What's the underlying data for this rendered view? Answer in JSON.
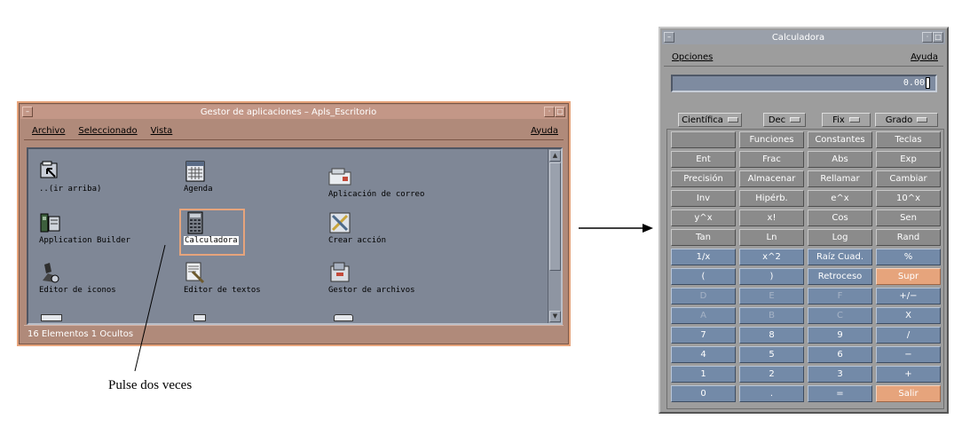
{
  "app_manager": {
    "title": "Gestor de aplicaciones – Apls_Escritorio",
    "menu": {
      "file": "Archivo",
      "selected": "Seleccionado",
      "view": "Vista",
      "help": "Ayuda"
    },
    "icons": [
      {
        "label": "..(ir arriba)",
        "icon": "folder-up-icon"
      },
      {
        "label": "Agenda",
        "icon": "calendar-icon"
      },
      {
        "label": "Aplicación de correo",
        "icon": "mail-icon"
      },
      {
        "label": "Application Builder",
        "icon": "builder-icon"
      },
      {
        "label": "Calculadora",
        "icon": "calculator-icon",
        "selected": true
      },
      {
        "label": "Crear acción",
        "icon": "create-action-icon"
      },
      {
        "label": "Editor de iconos",
        "icon": "icon-editor-icon"
      },
      {
        "label": "Editor de textos",
        "icon": "text-editor-icon"
      },
      {
        "label": "Gestor de archivos",
        "icon": "file-manager-icon"
      }
    ],
    "status": "16 Elementos 1 Ocultos",
    "accent_color": "#e6a47c"
  },
  "annotation": {
    "caption": "Pulse dos veces"
  },
  "calculator": {
    "title": "Calculadora",
    "menu": {
      "options": "Opciones",
      "help": "Ayuda"
    },
    "display": "0.00",
    "mode_selectors": [
      "Científica",
      "Dec",
      "Fix",
      "Grado"
    ],
    "keys": [
      [
        "",
        "Funciones",
        "Constantes",
        "Teclas"
      ],
      [
        "Ent",
        "Frac",
        "Abs",
        "Exp"
      ],
      [
        "Precisión",
        "Almacenar",
        "Rellamar",
        "Cambiar"
      ],
      [
        "Inv",
        "Hipérb.",
        "e^x",
        "10^x"
      ],
      [
        "y^x",
        "x!",
        "Cos",
        "Sen"
      ],
      [
        "Tan",
        "Ln",
        "Log",
        "Rand"
      ],
      [
        "1/x",
        "x^2",
        "Raíz Cuad.",
        "%"
      ],
      [
        "(",
        ")",
        "Retroceso",
        "Supr"
      ],
      [
        "D",
        "E",
        "F",
        "+/−"
      ],
      [
        "A",
        "B",
        "C",
        "X"
      ],
      [
        "7",
        "8",
        "9",
        "/"
      ],
      [
        "4",
        "5",
        "6",
        "−"
      ],
      [
        "1",
        "2",
        "3",
        "+"
      ],
      [
        "0",
        ".",
        "=",
        "Salir"
      ]
    ],
    "key_colors": {
      "function": "#8b8b8b",
      "digit": "#738aa8",
      "accent": "#e6a47c"
    }
  }
}
